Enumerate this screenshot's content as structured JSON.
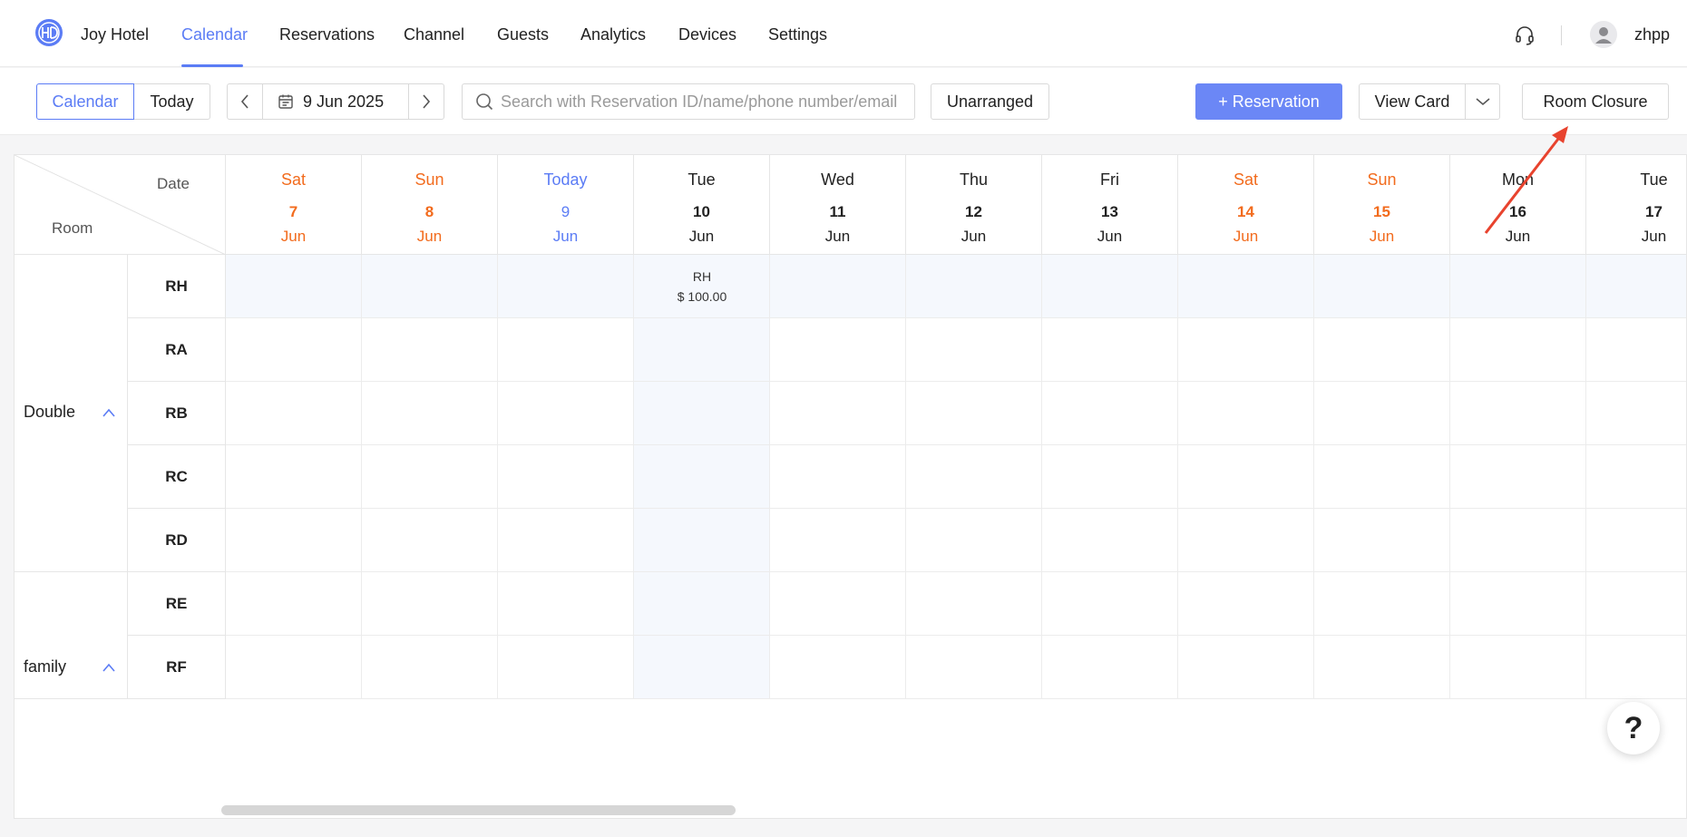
{
  "app": {
    "hotel_name": "Joy Hotel",
    "user_name": "zhpp",
    "accent": "#5b7cf5",
    "weekend_color": "#f26b1d"
  },
  "nav": {
    "items": [
      {
        "label": "Calendar",
        "active": true
      },
      {
        "label": "Reservations"
      },
      {
        "label": "Channel"
      },
      {
        "label": "Guests"
      },
      {
        "label": "Analytics"
      },
      {
        "label": "Devices"
      },
      {
        "label": "Settings"
      }
    ]
  },
  "toolbar": {
    "calendar_label": "Calendar",
    "today_label": "Today",
    "date_value": "9 Jun 2025",
    "search_placeholder": "Search with Reservation ID/name/phone number/email",
    "unarranged_label": "Unarranged",
    "reservation_label": "+ Reservation",
    "view_card_label": "View Card",
    "room_closure_label": "Room Closure"
  },
  "grid": {
    "corner_date": "Date",
    "corner_room": "Room",
    "days": [
      {
        "dow": "Sat",
        "num": "7",
        "mon": "Jun",
        "kind": "weekend"
      },
      {
        "dow": "Sun",
        "num": "8",
        "mon": "Jun",
        "kind": "weekend"
      },
      {
        "dow": "Today",
        "num": "9",
        "mon": "Jun",
        "kind": "today"
      },
      {
        "dow": "Tue",
        "num": "10",
        "mon": "Jun",
        "kind": "normal"
      },
      {
        "dow": "Wed",
        "num": "11",
        "mon": "Jun",
        "kind": "normal"
      },
      {
        "dow": "Thu",
        "num": "12",
        "mon": "Jun",
        "kind": "normal"
      },
      {
        "dow": "Fri",
        "num": "13",
        "mon": "Jun",
        "kind": "normal"
      },
      {
        "dow": "Sat",
        "num": "14",
        "mon": "Jun",
        "kind": "weekend"
      },
      {
        "dow": "Sun",
        "num": "15",
        "mon": "Jun",
        "kind": "weekend"
      },
      {
        "dow": "Mon",
        "num": "16",
        "mon": "Jun",
        "kind": "normal"
      },
      {
        "dow": "Tue",
        "num": "17",
        "mon": "Jun",
        "kind": "normal"
      }
    ],
    "groups": [
      {
        "name": "Double",
        "rooms": [
          "RH",
          "RA",
          "RB",
          "RC",
          "RD"
        ]
      },
      {
        "name": "family",
        "rooms": [
          "RE",
          "RF"
        ]
      }
    ],
    "rate_cell": {
      "room_code": "RH",
      "price": "$ 100.00"
    }
  },
  "help_label": "?"
}
